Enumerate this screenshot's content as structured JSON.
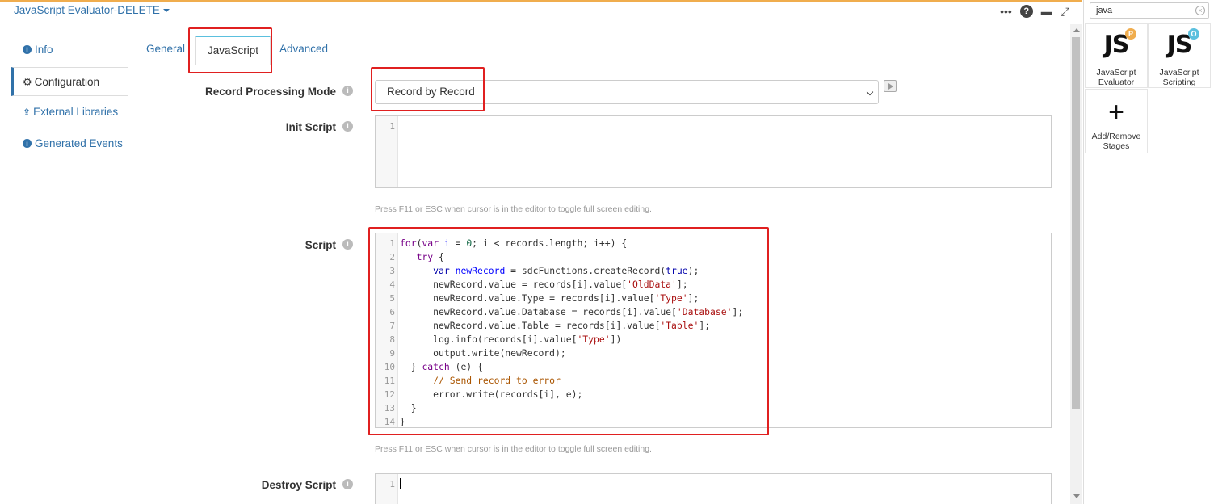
{
  "header": {
    "title": "JavaScript Evaluator-DELETE",
    "icons": [
      "more-icon",
      "help-icon",
      "minimize-icon",
      "maximize-icon"
    ]
  },
  "leftnav": {
    "items": [
      {
        "label": "Info",
        "icon": "info-icon"
      },
      {
        "label": "Configuration",
        "icon": "gear-icon"
      },
      {
        "label": "External Libraries",
        "icon": "upload-icon"
      },
      {
        "label": "Generated Events",
        "icon": "info-icon"
      }
    ],
    "active": "Configuration"
  },
  "tabs": [
    {
      "label": "General"
    },
    {
      "label": "JavaScript"
    },
    {
      "label": "Advanced"
    }
  ],
  "form": {
    "record_mode": {
      "label": "Record Processing Mode",
      "value": "Record by Record"
    },
    "init_script": {
      "label": "Init Script",
      "lines": [
        "1"
      ]
    },
    "script": {
      "label": "Script",
      "line_count": 14
    },
    "destroy_script": {
      "label": "Destroy Script",
      "lines": [
        "1"
      ]
    },
    "hint": "Press F11 or ESC when cursor is in the editor to toggle full screen editing."
  },
  "library": {
    "search_value": "java",
    "stages": [
      {
        "name": "JavaScript Evaluator",
        "glyph": "JS",
        "badge": "P",
        "badge_color": "#f0ad4e"
      },
      {
        "name": "JavaScript Scripting",
        "glyph": "JS",
        "badge": "O",
        "badge_color": "#5bc0de"
      },
      {
        "name": "Add/Remove Stages",
        "glyph": "+"
      }
    ]
  },
  "colors": {
    "link": "#3071a9",
    "annotation": "#e02020",
    "accent": "#f0ad4e"
  }
}
